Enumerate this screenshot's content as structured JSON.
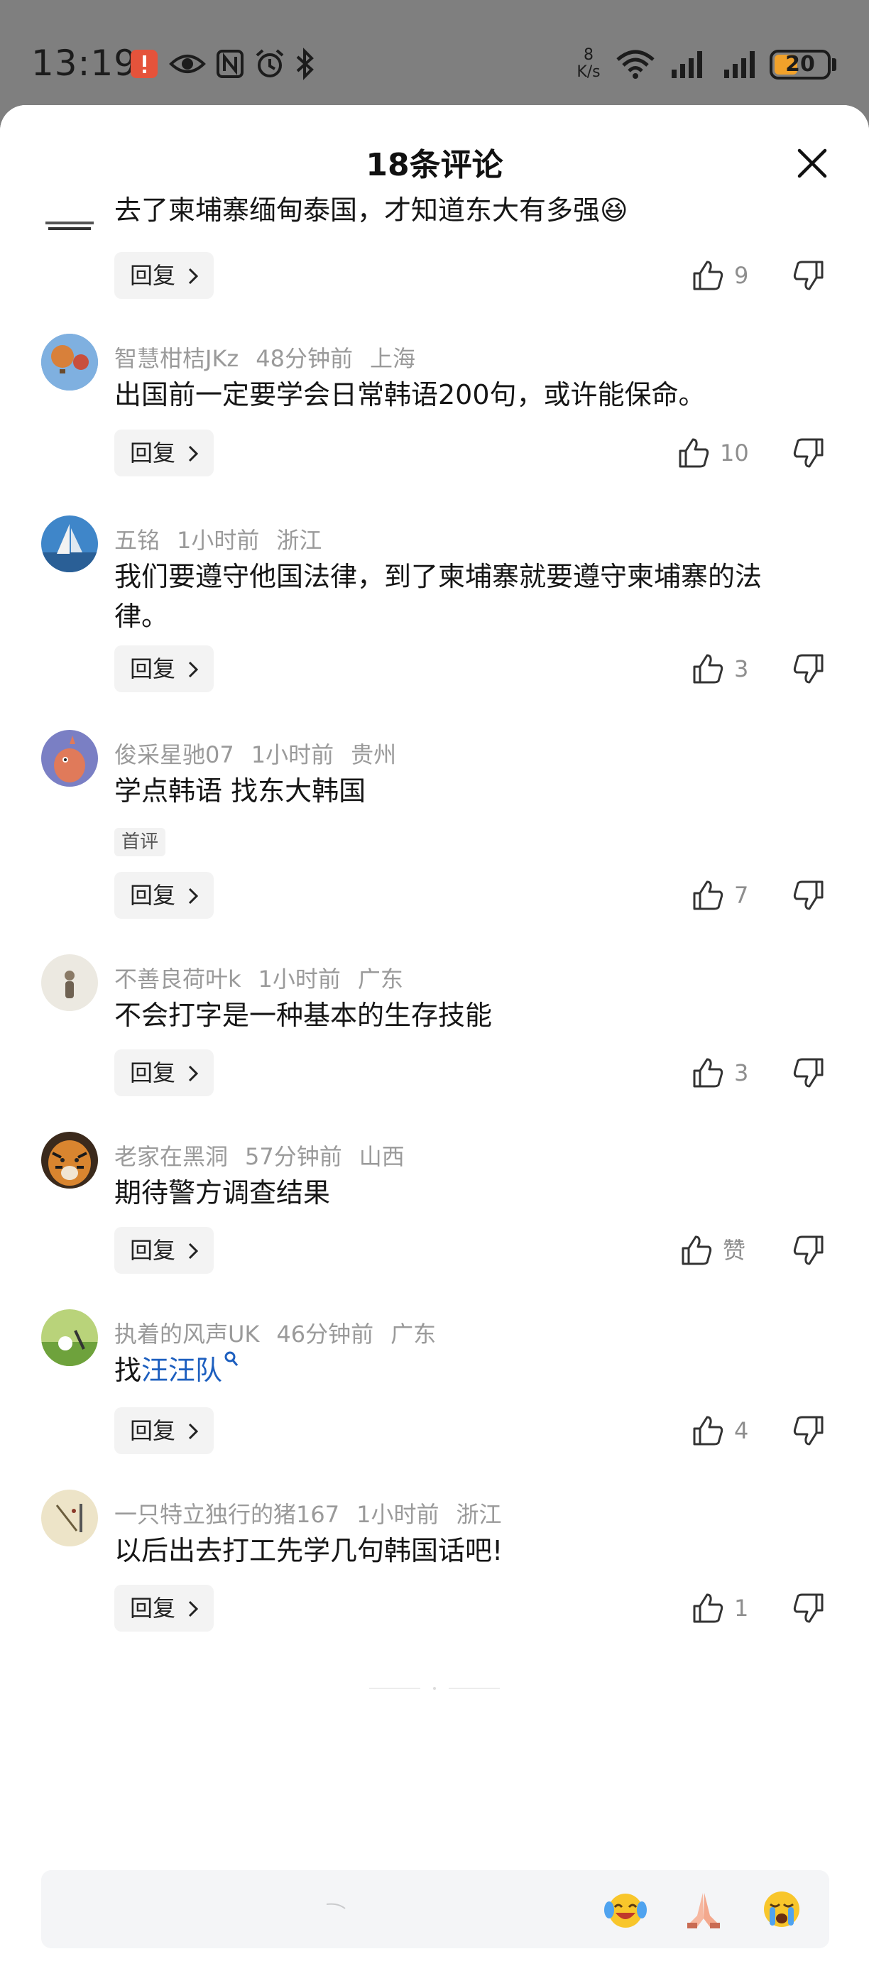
{
  "status_bar": {
    "time": "13:19",
    "net_speed_value": "8",
    "net_speed_unit": "K/s",
    "battery": "20",
    "icons": [
      "alert-icon",
      "eye-icon",
      "nfc-icon",
      "alarm-icon",
      "bluetooth-icon",
      "wifi-icon",
      "signal-icon",
      "signal-icon"
    ]
  },
  "header": {
    "title": "18条评论"
  },
  "reply_label": "回复",
  "first_comment_tag": "首评",
  "comments": [
    {
      "user": "",
      "time": "",
      "location": "",
      "text": "去了柬埔寨缅甸泰国，才知道东大有多强😆",
      "likes": "9"
    },
    {
      "user": "智慧柑桔JKz",
      "time": "48分钟前",
      "location": "上海",
      "text": "出国前一定要学会日常韩语200句，或许能保命。",
      "likes": "10"
    },
    {
      "user": "五铭",
      "time": "1小时前",
      "location": "浙江",
      "text": "我们要遵守他国法律，到了柬埔寨就要遵守柬埔寨的法律。",
      "likes": "3"
    },
    {
      "user": "俊采星驰07",
      "time": "1小时前",
      "location": "贵州",
      "text": "学点韩语 找东大韩国",
      "likes": "7"
    },
    {
      "user": "不善良荷叶k",
      "time": "1小时前",
      "location": "广东",
      "text": "不会打字是一种基本的生存技能",
      "likes": "3"
    },
    {
      "user": "老家在黑洞",
      "time": "57分钟前",
      "location": "山西",
      "text": "期待警方调查结果",
      "likes": "赞"
    },
    {
      "user": "执着的风声UK",
      "time": "46分钟前",
      "location": "广东",
      "text_prefix": "找",
      "link": "汪汪队",
      "likes": "4"
    },
    {
      "user": "一只特立独行的猪167",
      "time": "1小时前",
      "location": "浙江",
      "text": "以后出去打工先学几句韩国话吧!",
      "likes": "1"
    }
  ],
  "input": {
    "emojis": [
      "laughing-crying-emoji",
      "praying-hands-emoji",
      "crying-emoji"
    ]
  },
  "colors": {
    "link": "#1d5fbf",
    "battery": "#f1a12a",
    "status_bar_bg": "#7f7f7f"
  }
}
